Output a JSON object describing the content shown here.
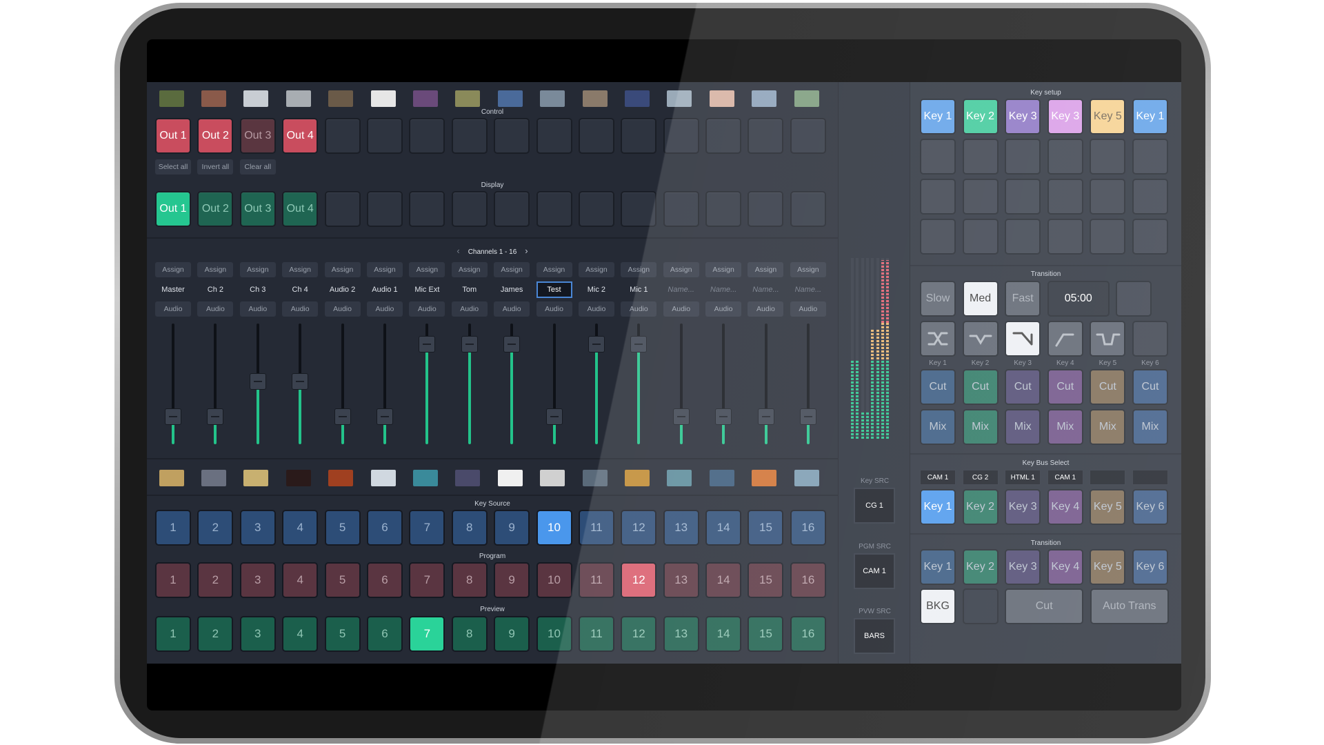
{
  "control": {
    "title": "Control",
    "outs": [
      {
        "label": "Out 1",
        "state": "on"
      },
      {
        "label": "Out 2",
        "state": "on"
      },
      {
        "label": "Out 3",
        "state": "dim"
      },
      {
        "label": "Out 4",
        "state": "on"
      }
    ],
    "empty": 12,
    "actions": [
      "Select all",
      "Invert all",
      "Clear all"
    ]
  },
  "display": {
    "title": "Display",
    "outs": [
      {
        "label": "Out 1",
        "state": "on"
      },
      {
        "label": "Out 2",
        "state": "off"
      },
      {
        "label": "Out 3",
        "state": "off"
      },
      {
        "label": "Out 4",
        "state": "off"
      }
    ],
    "empty": 12
  },
  "channels": {
    "title": "Channels 1 - 16",
    "prev_icon": "‹",
    "next_icon": "›",
    "assign": "Assign",
    "audio": "Audio",
    "names": [
      {
        "v": "Master"
      },
      {
        "v": "Ch 2"
      },
      {
        "v": "Ch 3"
      },
      {
        "v": "Ch 4"
      },
      {
        "v": "Audio 2"
      },
      {
        "v": "Audio 1"
      },
      {
        "v": "Mic Ext"
      },
      {
        "v": "Tom"
      },
      {
        "v": "James"
      },
      {
        "v": "Test",
        "editing": true
      },
      {
        "v": "Mic 2"
      },
      {
        "v": "Mic 1"
      },
      {
        "v": "Name...",
        "placeholder": true
      },
      {
        "v": "Name...",
        "placeholder": true
      },
      {
        "v": "Name...",
        "placeholder": true
      },
      {
        "v": "Name...",
        "placeholder": true
      }
    ],
    "fader_levels": [
      0.18,
      0.18,
      0.52,
      0.52,
      0.18,
      0.18,
      0.88,
      0.88,
      0.88,
      0.18,
      0.88,
      0.88,
      0.18,
      0.18,
      0.18,
      0.18
    ]
  },
  "thumb_colors_top": [
    "#5a6b3e",
    "#8a5a4a",
    "#c8cdd3",
    "#a8adb2",
    "#6a5a48",
    "#e6e6e6",
    "#6a4a7a",
    "#8a8a5a",
    "#4a6a9a",
    "#7a8a9a",
    "#8a7a6a",
    "#3a4a7a",
    "#9aaab8",
    "#d6b0a0",
    "#8aa0b8",
    "#7a9a7a"
  ],
  "thumb_colors_bottom": [
    "#c0a060",
    "#6a7080",
    "#c8b070",
    "#2a1a1a",
    "#a04020",
    "#d0d8e0",
    "#3a8a9a",
    "#4a4a6a",
    "#f0f0f0",
    "#d0d0d0",
    "#5a6a7a",
    "#c08a30",
    "#5a8a9a",
    "#3a5a7a",
    "#d07030",
    "#7a9ab0"
  ],
  "key_source": {
    "title": "Key Source",
    "selected": 10
  },
  "program": {
    "title": "Program",
    "selected": 12
  },
  "preview": {
    "title": "Preview",
    "selected": 7
  },
  "numbers": [
    "1",
    "2",
    "3",
    "4",
    "5",
    "6",
    "7",
    "8",
    "9",
    "10",
    "11",
    "12",
    "13",
    "14",
    "15",
    "16"
  ],
  "meters": {
    "levels": [
      0.44,
      0.44,
      0.15,
      0.15,
      0.61,
      0.61,
      0.99,
      0.99
    ]
  },
  "sources": {
    "key_label": "Key SRC",
    "key_value": "CG 1",
    "pgm_label": "PGM SRC",
    "pgm_value": "CAM 1",
    "pvw_label": "PVW SRC",
    "pvw_value": "BARS"
  },
  "key_setup": {
    "title": "Key setup",
    "keys": [
      {
        "label": "Key 1",
        "color": "#5fa0e8"
      },
      {
        "label": "Key 2",
        "color": "#3ec99a"
      },
      {
        "label": "Key 3",
        "color": "#8b74c4"
      },
      {
        "label": "Key 3",
        "color": "#d99be6"
      },
      {
        "label": "Key 5",
        "color": "#f6d08e"
      },
      {
        "label": "Key 1",
        "color": "#5fa0e8"
      }
    ]
  },
  "transition": {
    "title": "Transition",
    "speeds": [
      "Slow",
      "Med",
      "Fast"
    ],
    "speed_selected": "Med",
    "time": "05:00",
    "curves": [
      "crossfade-icon",
      "dip-icon",
      "fall-icon",
      "rise-icon",
      "notch-icon"
    ],
    "curve_selected": 2,
    "key_labels": [
      "Key 1",
      "Key 2",
      "Key 3",
      "Key 4",
      "Key 5",
      "Key 6"
    ],
    "cut": "Cut",
    "mix": "Mix"
  },
  "key_colors": [
    "#35577f",
    "#2a7762",
    "#4d4770",
    "#6d4f85",
    "#7d6a52",
    "#3b5a86"
  ],
  "key_bus": {
    "title": "Key Bus Select",
    "sources": [
      "CAM 1",
      "CG 2",
      "HTML 1",
      "CAM 1",
      "",
      ""
    ],
    "keys": [
      "Key 1",
      "Key 2",
      "Key 3",
      "Key 4",
      "Key 5",
      "Key 6"
    ],
    "selected": 0
  },
  "transition2": {
    "title": "Transition",
    "keys": [
      "Key 1",
      "Key 2",
      "Key 3",
      "Key 4",
      "Key 5",
      "Key 6"
    ],
    "bkg": "BKG",
    "cut": "Cut",
    "auto": "Auto Trans"
  }
}
